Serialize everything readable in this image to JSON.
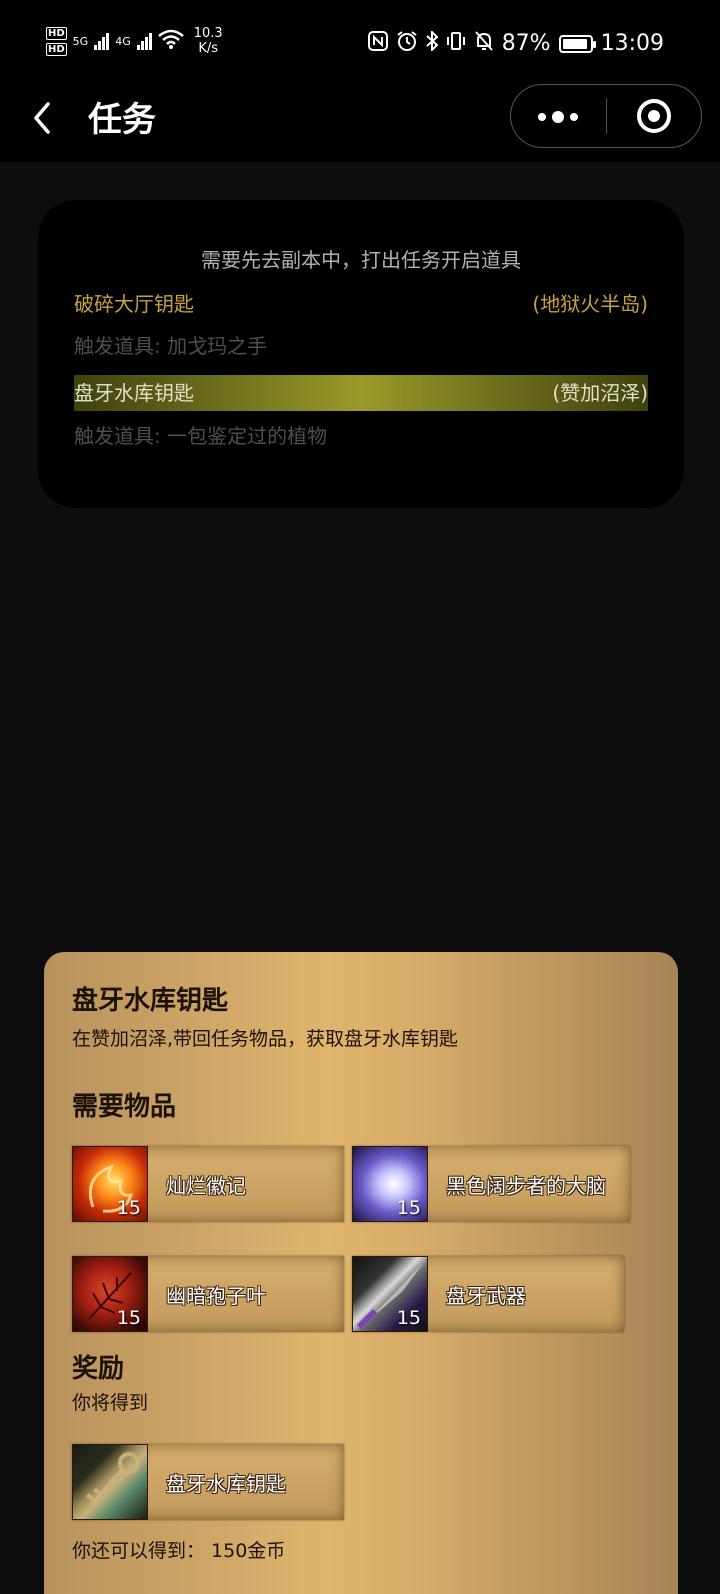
{
  "status_bar": {
    "hd1": "HD",
    "hd2": "HD",
    "net1": "5G",
    "net2": "4G",
    "speed_value": "10.3",
    "speed_unit": "K/s",
    "battery": "87%",
    "time": "13:09"
  },
  "nav": {
    "title": "任务"
  },
  "quest_list": {
    "hint": "需要先去副本中，打出任务开启道具",
    "items": [
      {
        "name": "破碎大厅钥匙",
        "zone": "(地狱火半岛)",
        "trigger": "触发道具: 加戈玛之手"
      },
      {
        "name": "盘牙水库钥匙",
        "zone": "(赞加沼泽)",
        "trigger": "触发道具: 一包鉴定过的植物"
      }
    ]
  },
  "detail": {
    "title": "盘牙水库钥匙",
    "description": "在赞加沼泽,带回任务物品，获取盘牙水库钥匙",
    "need_heading": "需要物品",
    "required_items": [
      {
        "name": "灿烂徽记",
        "count": "15",
        "icon": "fire-emblem-icon"
      },
      {
        "name": "黑色阔步者的大脑",
        "count": "15",
        "icon": "glowing-brain-icon"
      },
      {
        "name": "幽暗孢子叶",
        "count": "15",
        "icon": "red-leaf-icon"
      },
      {
        "name": "盘牙武器",
        "count": "15",
        "icon": "spear-weapon-icon"
      }
    ],
    "reward_heading": "奖励",
    "reward_sub": "你将得到",
    "reward_item": {
      "name": "盘牙水库钥匙",
      "icon": "key-icon"
    },
    "extra_reward": "你还可以得到：  150金币"
  }
}
